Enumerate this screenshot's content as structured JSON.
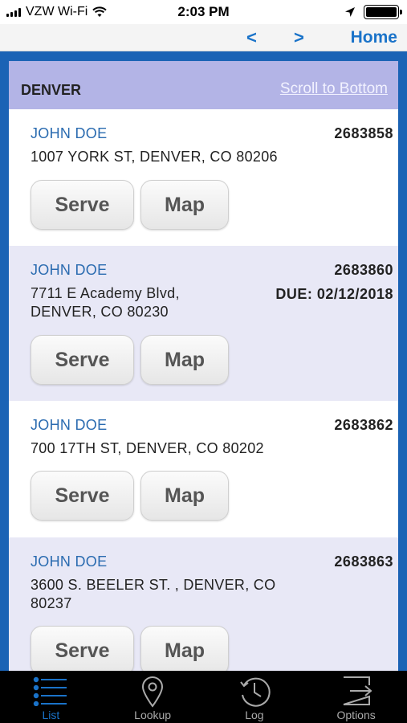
{
  "status": {
    "carrier": "VZW Wi-Fi",
    "time": "2:03 PM"
  },
  "nav": {
    "prev": "<",
    "next": ">",
    "home": "Home"
  },
  "group": {
    "title": "DENVER",
    "scroll_link": "Scroll to Bottom"
  },
  "records": [
    {
      "name": "JOHN DOE",
      "number": "2683858",
      "address_lines": [
        "1007 YORK ST, DENVER, CO 80206"
      ],
      "due": ""
    },
    {
      "name": "JOHN DOE",
      "number": "2683860",
      "address_lines": [
        "7711 E Academy Blvd,",
        "DENVER, CO 80230"
      ],
      "due": "DUE: 02/12/2018"
    },
    {
      "name": "JOHN DOE",
      "number": "2683862",
      "address_lines": [
        "700 17TH ST, DENVER, CO 80202"
      ],
      "due": ""
    },
    {
      "name": "JOHN DOE",
      "number": "2683863",
      "address_lines": [
        "3600 S. BEELER ST. , DENVER, CO",
        "80237"
      ],
      "due": ""
    }
  ],
  "buttons": {
    "serve": "Serve",
    "map": "Map"
  },
  "tabs": [
    {
      "label": "List",
      "icon": "list-icon",
      "active": true
    },
    {
      "label": "Lookup",
      "icon": "location-pin-icon",
      "active": false
    },
    {
      "label": "Log",
      "icon": "clock-history-icon",
      "active": false
    },
    {
      "label": "Options",
      "icon": "exit-icon",
      "active": false
    }
  ],
  "colors": {
    "accent": "#1a73c9",
    "frame": "#1b63b5",
    "header": "#b3b4e6",
    "alt_row": "#e8e8f6"
  }
}
